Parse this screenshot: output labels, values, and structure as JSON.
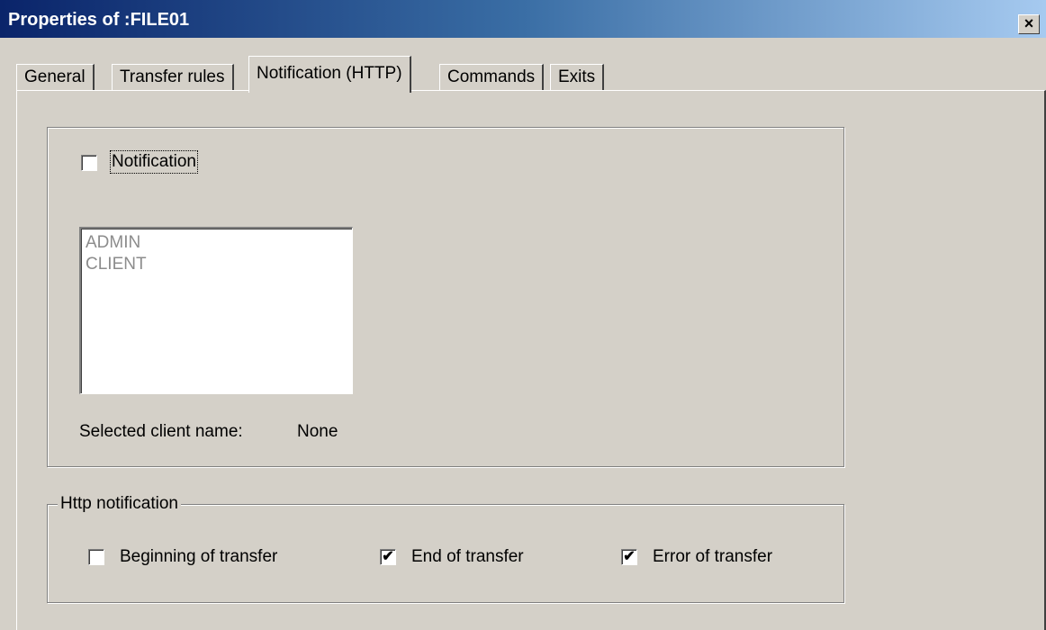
{
  "window": {
    "title": "Properties of :FILE01",
    "close_glyph": "×"
  },
  "tabs": [
    {
      "label": "General",
      "active": false
    },
    {
      "label": "Transfer rules",
      "active": false
    },
    {
      "label": "Notification (HTTP)",
      "active": true
    },
    {
      "label": "Commands",
      "active": false
    },
    {
      "label": "Exits",
      "active": false
    }
  ],
  "notification": {
    "checkbox_label": "Notification",
    "checked": false,
    "clients": [
      "ADMIN",
      "CLIENT"
    ],
    "selected_client_label": "Selected client name:",
    "selected_client_value": "None"
  },
  "http_notification": {
    "group_label": "Http notification",
    "options": [
      {
        "label": "Beginning of transfer",
        "checked": false
      },
      {
        "label": "End of transfer",
        "checked": true
      },
      {
        "label": "Error of transfer",
        "checked": true
      }
    ]
  },
  "icons": {
    "check": "check-mark-icon",
    "close": "close-icon"
  }
}
